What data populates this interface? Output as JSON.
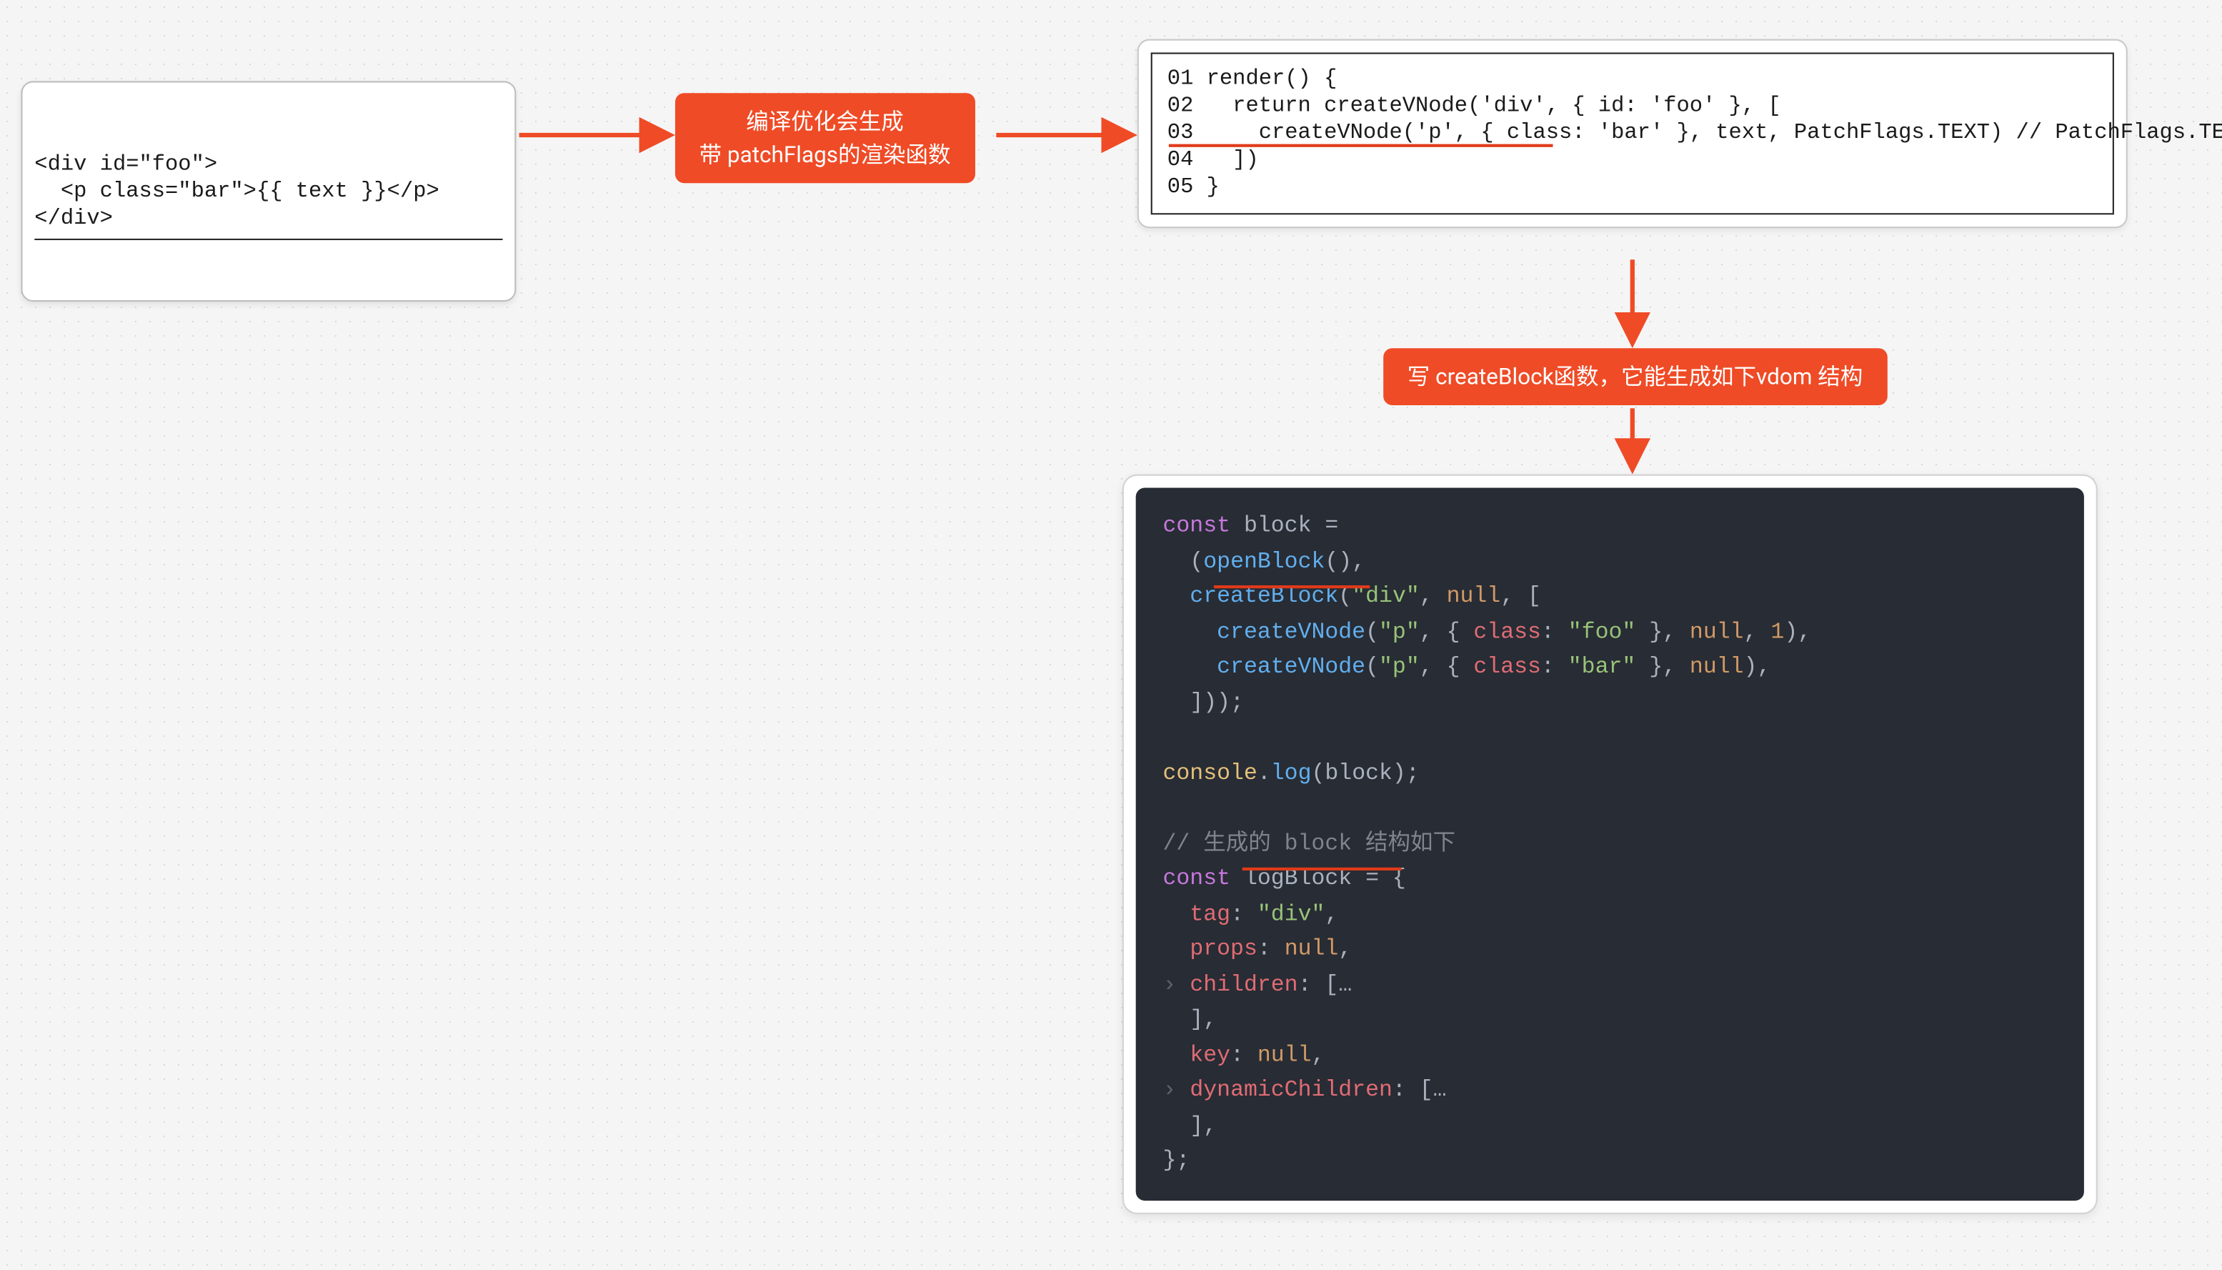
{
  "box1": {
    "line1": "<div id=\"foo\">",
    "line2": "  <p class=\"bar\">{{ text }}</p>",
    "line3": "</div>"
  },
  "label1": {
    "line1": "编译优化会生成",
    "line2": "带 patchFlags的渲染函数"
  },
  "box2": {
    "l1": "01 render() {",
    "l2": "02   return createVNode('div', { id: 'foo' }, [",
    "l3a": "03     createVNode('p', { class: 'bar' }, text, PatchFlags.TEXT) // ",
    "l3b": "PatchFlags.TEXT 就是补丁标志",
    "l4": "04   ])",
    "l5": "05 }"
  },
  "label2": "写 createBlock函数，它能生成如下vdom 结构",
  "box3": {
    "t": {
      "const": "const",
      "block": "block",
      "eq": " =",
      "openBlock": "openBlock",
      "createBlock": "createBlock",
      "div": "\"div\"",
      "null": "null",
      "createVNode": "createVNode",
      "p": "\"p\"",
      "class": "class",
      "foo": "\"foo\"",
      "bar": "\"bar\"",
      "one": "1",
      "console": "console",
      "log": "log",
      "comment": "// 生成的 block 结构如下",
      "logBlock": "logBlock",
      "tag": "tag",
      "props": "props",
      "children": "children",
      "key": "key",
      "dynamicChildren": "dynamicChildren",
      "dots": "…"
    }
  }
}
